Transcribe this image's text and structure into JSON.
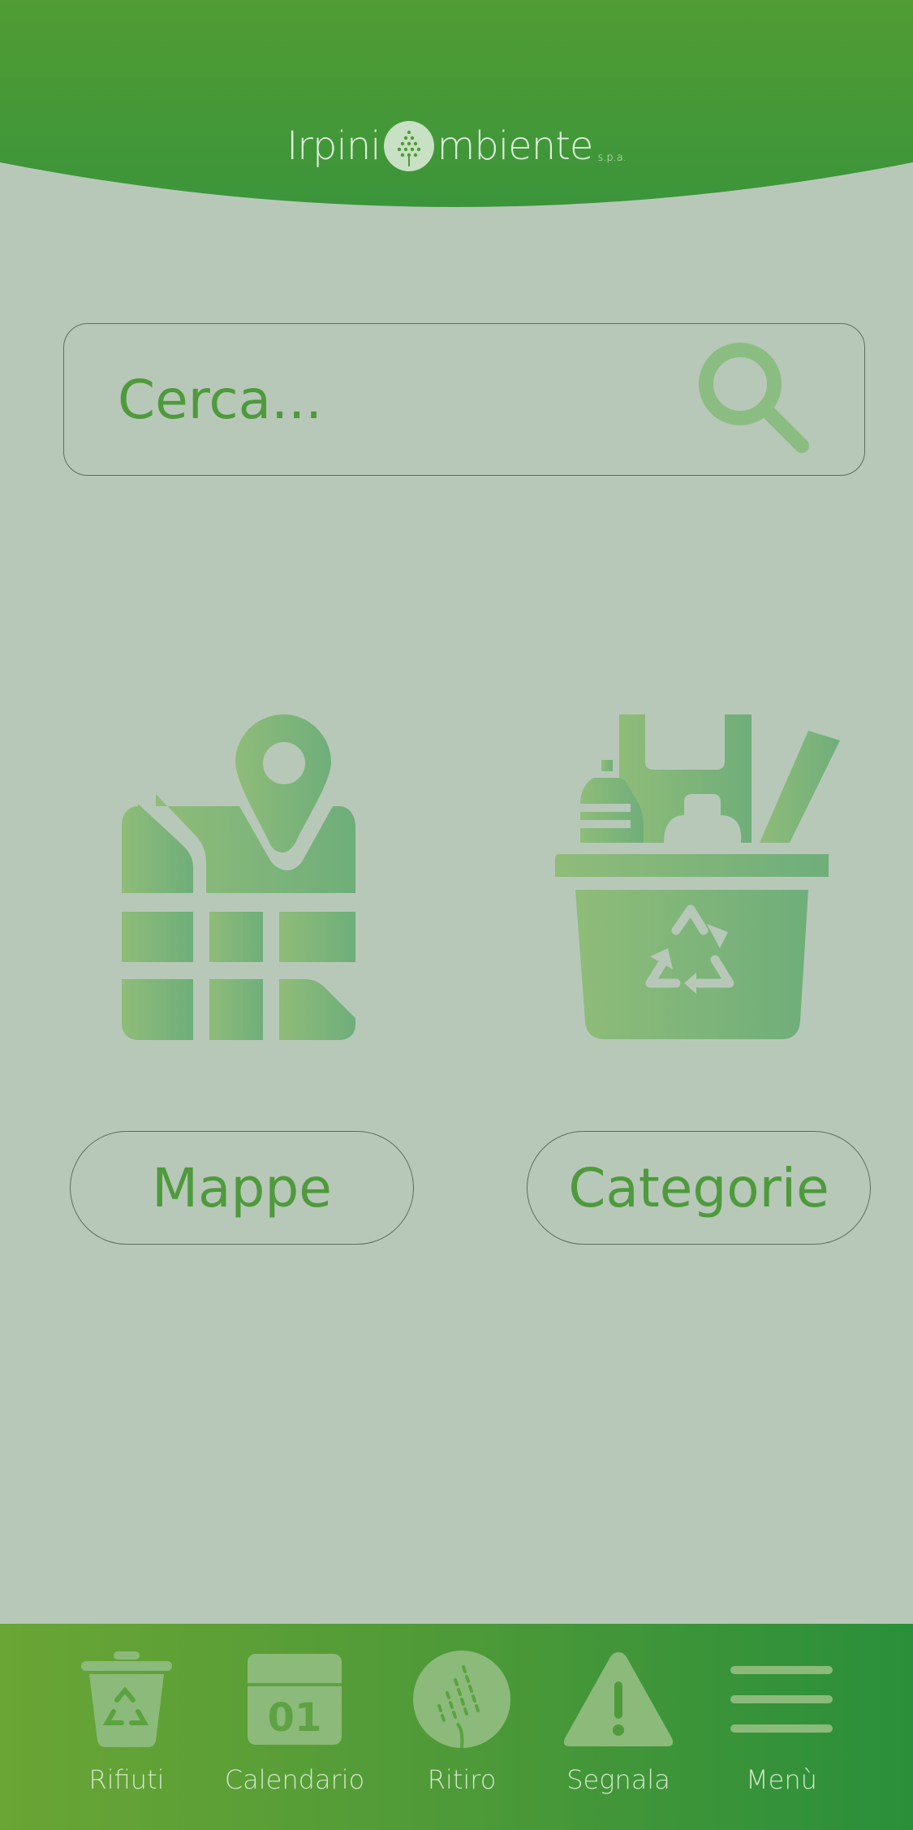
{
  "header": {
    "logo_left": "Irpini",
    "logo_right": "mbiente",
    "logo_suffix": "s.p.a.",
    "colors": {
      "top": "#4f9b35",
      "bottom": "#3a943a"
    }
  },
  "search": {
    "placeholder": "Cerca...",
    "icon": "search-icon"
  },
  "tiles": [
    {
      "icon": "map-pin-icon",
      "label": "Mappe"
    },
    {
      "icon": "recycling-basket-icon",
      "label": "Categorie"
    }
  ],
  "bottom_nav": {
    "items": [
      {
        "icon": "recycle-bin-icon",
        "label": "Rifiuti"
      },
      {
        "icon": "calendar-icon",
        "label": "Calendario",
        "icon_text": "01"
      },
      {
        "icon": "pickup-drop-icon",
        "label": "Ritiro"
      },
      {
        "icon": "warning-icon",
        "label": "Segnala"
      },
      {
        "icon": "hamburger-menu-icon",
        "label": "Menù"
      }
    ]
  },
  "theme": {
    "background": "#b7c8b8",
    "accent": "#4e9a3c",
    "icon_gradient_start": "#8fbc79",
    "icon_gradient_end": "#6fae7a"
  }
}
